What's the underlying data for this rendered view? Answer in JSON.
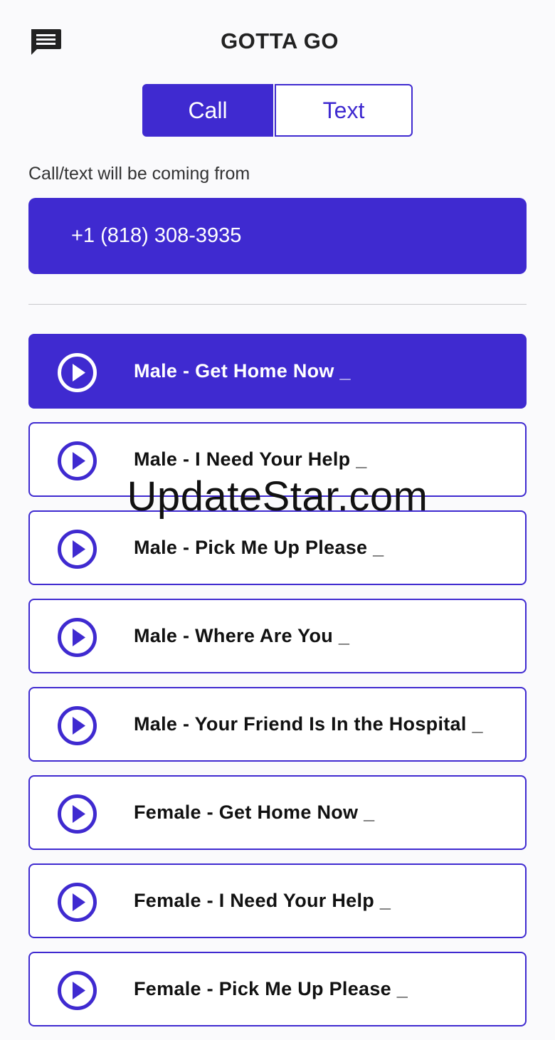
{
  "header": {
    "title": "GOTTA GO",
    "message_icon": "chat-message-icon"
  },
  "mode_toggle": {
    "call_label": "Call",
    "text_label": "Text",
    "selected": "Call"
  },
  "caller": {
    "label": "Call/text will be coming from",
    "phone_number": "+1 (818) 308-3935"
  },
  "scenarios": [
    {
      "label": "Male - Get Home Now _",
      "active": true,
      "icon": "play-circle-icon"
    },
    {
      "label": "Male - I Need Your Help _",
      "active": false,
      "icon": "play-circle-icon"
    },
    {
      "label": "Male - Pick Me Up Please _",
      "active": false,
      "icon": "play-circle-icon"
    },
    {
      "label": "Male - Where Are You _",
      "active": false,
      "icon": "play-circle-icon"
    },
    {
      "label": "Male - Your Friend Is In the Hospital _",
      "active": false,
      "icon": "play-circle-icon"
    },
    {
      "label": "Female - Get Home Now _",
      "active": false,
      "icon": "play-circle-icon"
    },
    {
      "label": "Female - I Need Your Help _",
      "active": false,
      "icon": "play-circle-icon"
    },
    {
      "label": "Female - Pick Me Up Please _",
      "active": false,
      "icon": "play-circle-icon"
    }
  ],
  "watermark": "UpdateStar.com",
  "colors": {
    "accent": "#3f2ad0",
    "background": "#fafafc",
    "text": "#111111"
  }
}
